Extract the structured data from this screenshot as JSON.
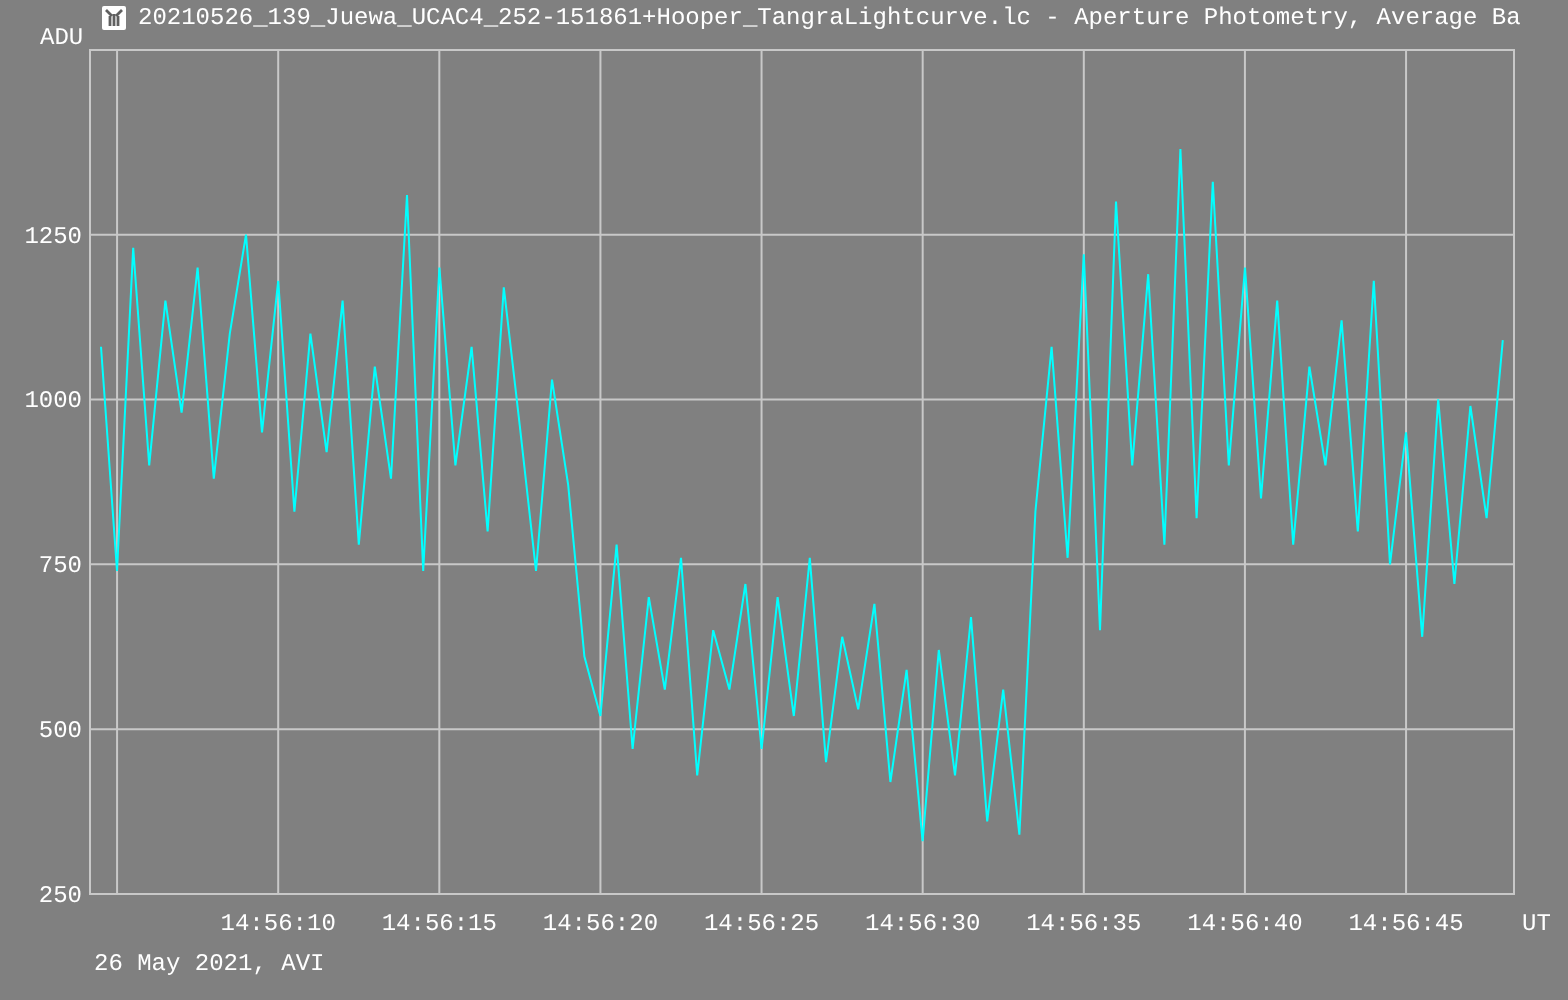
{
  "window": {
    "title": "20210526_139_Juewa_UCAC4_252-151861+Hooper_TangraLightcurve.lc - Aperture Photometry, Average Ba"
  },
  "chart": {
    "chart_data": {
      "type": "line",
      "grid": true,
      "ylabel": "ADU",
      "xlabel": "UT",
      "x": [
        53764.5,
        53765,
        53765.5,
        53766,
        53766.5,
        53767,
        53767.5,
        53768,
        53768.5,
        53769,
        53769.5,
        53770,
        53770.5,
        53771,
        53771.5,
        53772,
        53772.5,
        53773,
        53773.5,
        53774,
        53774.5,
        53775,
        53775.5,
        53776,
        53776.5,
        53777,
        53777.5,
        53778,
        53778.5,
        53779,
        53779.5,
        53780,
        53780.5,
        53781,
        53781.5,
        53782,
        53782.5,
        53783,
        53783.5,
        53784,
        53784.5,
        53785,
        53785.5,
        53786,
        53786.5,
        53787,
        53787.5,
        53788,
        53788.5,
        53789,
        53789.5,
        53790,
        53790.5,
        53791,
        53791.5,
        53792,
        53792.5,
        53793,
        53793.5,
        53794,
        53794.5,
        53795,
        53795.5,
        53796,
        53796.5,
        53797,
        53797.5,
        53798,
        53798.5,
        53799,
        53799.5,
        53800,
        53800.5,
        53801,
        53801.5,
        53802,
        53802.5,
        53803,
        53803.5,
        53804,
        53804.5,
        53805,
        53805.5,
        53806,
        53806.5,
        53807,
        53807.5,
        53808
      ],
      "series": [
        {
          "color": "#00ffff",
          "values": [
            1080,
            740,
            1230,
            900,
            1150,
            980,
            1200,
            880,
            1100,
            1250,
            950,
            1180,
            830,
            1100,
            920,
            1150,
            780,
            1050,
            880,
            1310,
            740,
            1200,
            900,
            1080,
            800,
            1170,
            960,
            740,
            1030,
            870,
            610,
            520,
            780,
            470,
            700,
            560,
            760,
            430,
            650,
            560,
            720,
            470,
            700,
            520,
            760,
            450,
            640,
            530,
            690,
            420,
            590,
            330,
            620,
            430,
            670,
            360,
            560,
            340,
            830,
            1080,
            760,
            1220,
            650,
            1300,
            900,
            1190,
            780,
            1380,
            820,
            1330,
            900,
            1200,
            850,
            1150,
            780,
            1050,
            900,
            1120,
            800,
            1180,
            750,
            950,
            640,
            1000,
            720,
            990,
            820,
            1090
          ]
        }
      ],
      "xlim": [
        53764.16,
        53808.35
      ],
      "ylim": [
        250,
        1530
      ],
      "xticks": [
        {
          "value": 53770,
          "label": "14:56:10"
        },
        {
          "value": 53775,
          "label": "14:56:15"
        },
        {
          "value": 53780,
          "label": "14:56:20"
        },
        {
          "value": 53785,
          "label": "14:56:25"
        },
        {
          "value": 53790,
          "label": "14:56:30"
        },
        {
          "value": 53795,
          "label": "14:56:35"
        },
        {
          "value": 53800,
          "label": "14:56:40"
        },
        {
          "value": 53805,
          "label": "14:56:45"
        }
      ],
      "yticks": [
        250,
        500,
        750,
        1000,
        1250
      ]
    }
  },
  "footer": {
    "caption": "26 May 2021, AVI"
  }
}
